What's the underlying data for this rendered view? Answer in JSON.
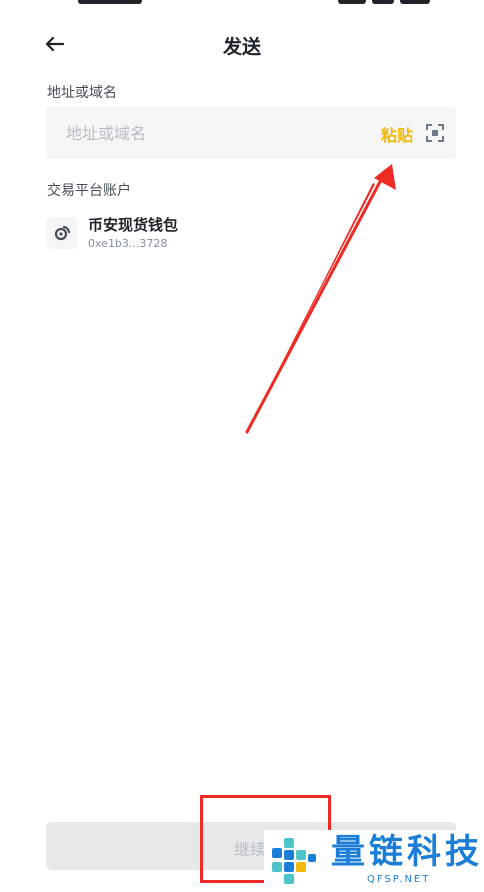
{
  "header": {
    "title": "发送"
  },
  "address": {
    "label": "地址或域名",
    "placeholder": "地址或域名",
    "value": "",
    "paste_label": "粘贴"
  },
  "exchange": {
    "section_label": "交易平台账户",
    "account": {
      "name": "币安现货钱包",
      "address": "0xe1b3...3728"
    }
  },
  "footer": {
    "continue_label": "继续"
  },
  "watermark": {
    "text": "量链科技",
    "subtext": "QFSP.NET"
  },
  "colors": {
    "accent": "#f0b90b",
    "annotation": "#ee2a24",
    "watermark": "#1a7ed8",
    "input_bg": "#f5f5f5",
    "disabled_bg": "#e6e8ea"
  }
}
